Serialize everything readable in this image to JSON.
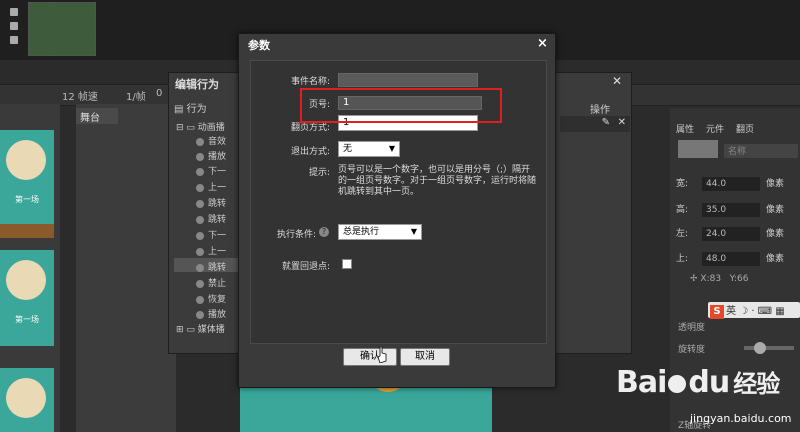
{
  "timeline": {
    "fps_label": "12 帧速",
    "frame_label": "1/帧",
    "frame_num": "0"
  },
  "stage": {
    "tab_label": "舞台"
  },
  "thumbnails": [
    {
      "label": "第一场"
    },
    {
      "label": "第一场"
    }
  ],
  "behavior_panel": {
    "title": "编辑行为",
    "tree_header": "行为",
    "op_header": "操作",
    "tree_items": [
      "动画播",
      "音效",
      "播放",
      "下一",
      "上一",
      "跳转",
      "跳转",
      "下一",
      "上一",
      "跳转",
      "禁止",
      "恢复",
      "播放",
      "媒体播"
    ]
  },
  "right_panel": {
    "tabs": [
      "属性",
      "元件",
      "翻页"
    ],
    "name_placeholder": "名称",
    "props": [
      {
        "label": "宽:",
        "value": "44.0",
        "unit": "像素"
      },
      {
        "label": "高:",
        "value": "35.0",
        "unit": "像素"
      },
      {
        "label": "左:",
        "value": "24.0",
        "unit": "像素"
      },
      {
        "label": "上:",
        "value": "48.0",
        "unit": "像素"
      }
    ],
    "x_label": "X:83",
    "y_label": "Y:66",
    "opacity_label": "透明度",
    "rotate_label": "旋转度",
    "z_rotate_label": "Z轴旋转",
    "ime_label": "英",
    "ime_logo": "S"
  },
  "dialog": {
    "title": "参数",
    "close_label": "×",
    "fields": {
      "event_name_label": "事件名称:",
      "page_no_label": "页号:",
      "page_no_value": "1",
      "flip_mode_label": "翻页方式:",
      "flip_mode_value": "1",
      "exit_mode_label": "退出方式:",
      "exit_mode_value": "无",
      "hint_label": "提示:",
      "hint_text": "页号可以是一个数字，也可以是用分号（;）隔开的一组页号数字。对于一组页号数字，运行时将随机跳转到其中一页。",
      "condition_label": "执行条件:",
      "condition_value": "总是执行",
      "restore_label": "就置回退点:"
    },
    "ok_label": "确认",
    "cancel_label": "取消"
  },
  "watermark": {
    "brand": "Bai",
    "brand2": "du",
    "cn": "经验",
    "url": "jingyan.baidu.com"
  }
}
